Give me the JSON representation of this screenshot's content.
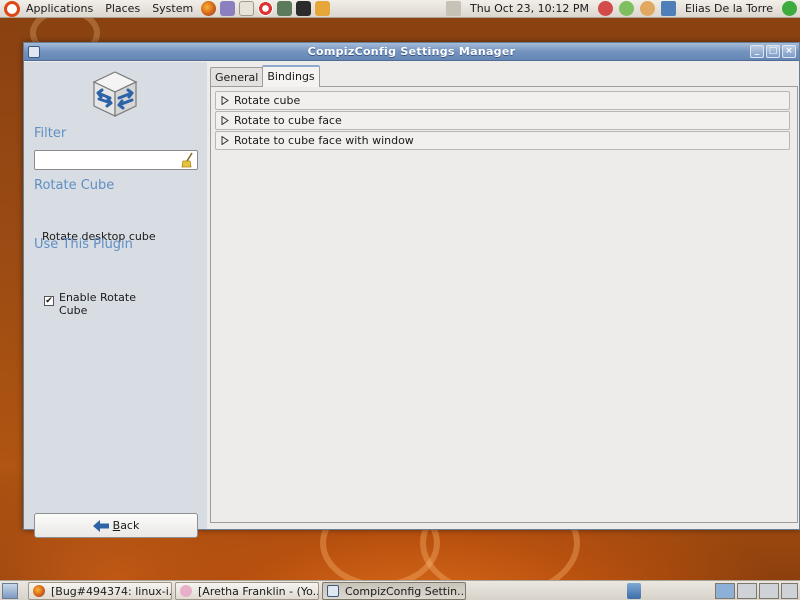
{
  "top_panel": {
    "menus": [
      "Applications",
      "Places",
      "System"
    ],
    "clock": "Thu Oct 23, 10:12 PM",
    "user": "Elias De la Torre"
  },
  "window": {
    "title": "CompizConfig Settings Manager",
    "buttons": {
      "minimize": "_",
      "maximize": "□",
      "close": "×"
    }
  },
  "sidebar": {
    "filter_heading": "Filter",
    "filter_value": "",
    "plugin_heading": "Rotate Cube",
    "plugin_description": "Rotate desktop cube",
    "use_heading": "Use This Plugin",
    "enable_label": "Enable Rotate Cube",
    "enable_checked": true,
    "back_label": "Back"
  },
  "tabs": [
    {
      "label": "General",
      "active": false
    },
    {
      "label": "Bindings",
      "active": true
    }
  ],
  "bindings": [
    "Rotate cube",
    "Rotate to cube face",
    "Rotate to cube face with window"
  ],
  "taskbar": {
    "tasks": [
      "[Bug#494374: linux-i...",
      "[Aretha Franklin - (Yo...",
      "CompizConfig Settin..."
    ]
  },
  "colors": {
    "accent": "#5f8fc3",
    "titlebar": "#7393bf",
    "sidebar": "#d8dce3"
  }
}
